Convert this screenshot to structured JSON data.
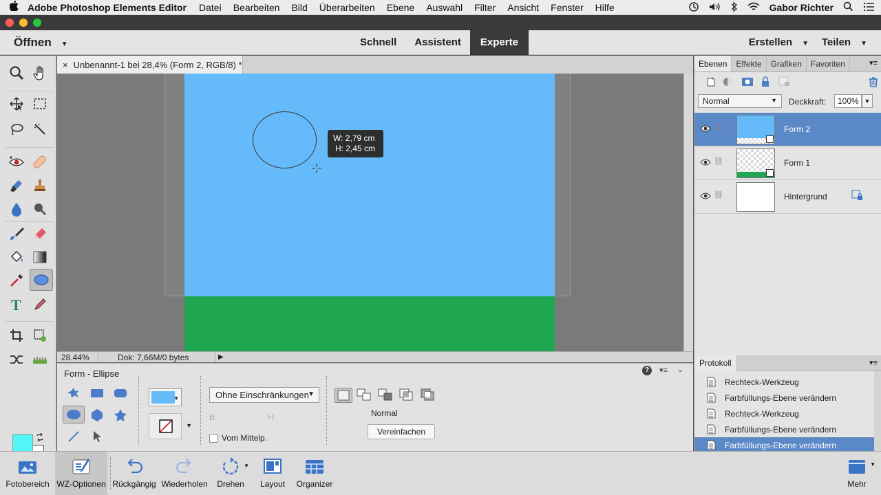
{
  "menubar": {
    "app_name": "Adobe Photoshop Elements Editor",
    "items": [
      "Datei",
      "Bearbeiten",
      "Bild",
      "Überarbeiten",
      "Ebene",
      "Auswahl",
      "Filter",
      "Ansicht",
      "Fenster",
      "Hilfe"
    ],
    "user": "Gabor Richter"
  },
  "topbar": {
    "open_label": "Öffnen",
    "modes": [
      "Schnell",
      "Assistent",
      "Experte"
    ],
    "active_mode": "Experte",
    "create_label": "Erstellen",
    "share_label": "Teilen"
  },
  "document": {
    "tab_label": "Unbenannt-1 bei 28,4% (Form 2, RGB/8) *",
    "tab_close": "×",
    "zoom": "28.44%",
    "doc_info": "Dok: 7,66M/0 bytes"
  },
  "canvas": {
    "sky_color": "#65bbfa",
    "grass_color": "#1fa651",
    "tooltip_w": "W: 2,79 cm",
    "tooltip_h": "H: 2,45 cm"
  },
  "options": {
    "title": "Form - Ellipse",
    "constraint": "Ohne Einschränkungen",
    "b_label": "B:",
    "h_label": "H:",
    "from_center": "Vom Mittelp.",
    "mode_label": "Normal",
    "simplify_label": "Vereinfachen",
    "fill_color": "#65bbfa"
  },
  "layers_panel": {
    "tabs": [
      "Ebenen",
      "Effekte",
      "Grafiken",
      "Favoriten"
    ],
    "blend_mode": "Normal",
    "opacity_label": "Deckkraft:",
    "opacity_value": "100%",
    "layers": [
      {
        "name": "Form 2",
        "active": true
      },
      {
        "name": "Form 1",
        "active": false
      },
      {
        "name": "Hintergrund",
        "active": false
      }
    ]
  },
  "history_panel": {
    "tab": "Protokoll",
    "items": [
      "Rechteck-Werkzeug",
      "Farbfüllungs-Ebene verändern",
      "Rechteck-Werkzeug",
      "Farbfüllungs-Ebene verändern",
      "Farbfüllungs-Ebene verändern"
    ]
  },
  "taskbar": {
    "items": [
      "Fotobereich",
      "WZ-Optionen",
      "Rückgängig",
      "Wiederholen",
      "Drehen",
      "Layout",
      "Organizer"
    ],
    "more": "Mehr"
  },
  "colors": {
    "foreground": "#54f7f7",
    "background": "#ffffff",
    "selection": "#5b88c6"
  }
}
